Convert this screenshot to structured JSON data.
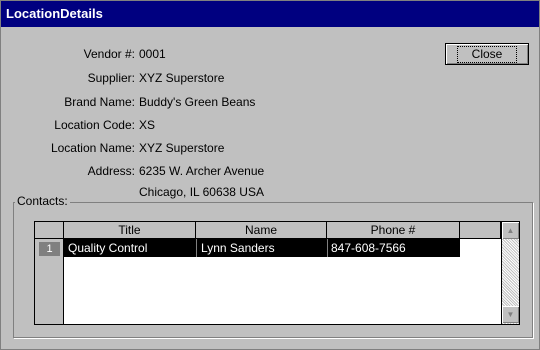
{
  "window": {
    "title": "LocationDetails"
  },
  "fields": [
    {
      "label": "Vendor #:",
      "value": "0001"
    },
    {
      "label": "Supplier:",
      "value": "XYZ Superstore"
    },
    {
      "label": "Brand Name:",
      "value": "Buddy's Green Beans"
    },
    {
      "label": "Location Code:",
      "value": "XS"
    },
    {
      "label": "Location Name:",
      "value": "XYZ Superstore"
    },
    {
      "label": "Address:",
      "value": "6235 W. Archer Avenue"
    },
    {
      "label": "",
      "value": "Chicago, IL 60638 USA"
    }
  ],
  "close_label": "Close",
  "contacts": {
    "label": "Contacts:",
    "columns": [
      "Title",
      "Name",
      "Phone #"
    ],
    "rows": [
      {
        "num": "1",
        "title": "Quality Control",
        "name": "Lynn Sanders",
        "phone": "847-608-7566"
      }
    ]
  },
  "icons": {
    "scroll_up": "arrow-up-icon",
    "scroll_down": "arrow-down-icon"
  }
}
